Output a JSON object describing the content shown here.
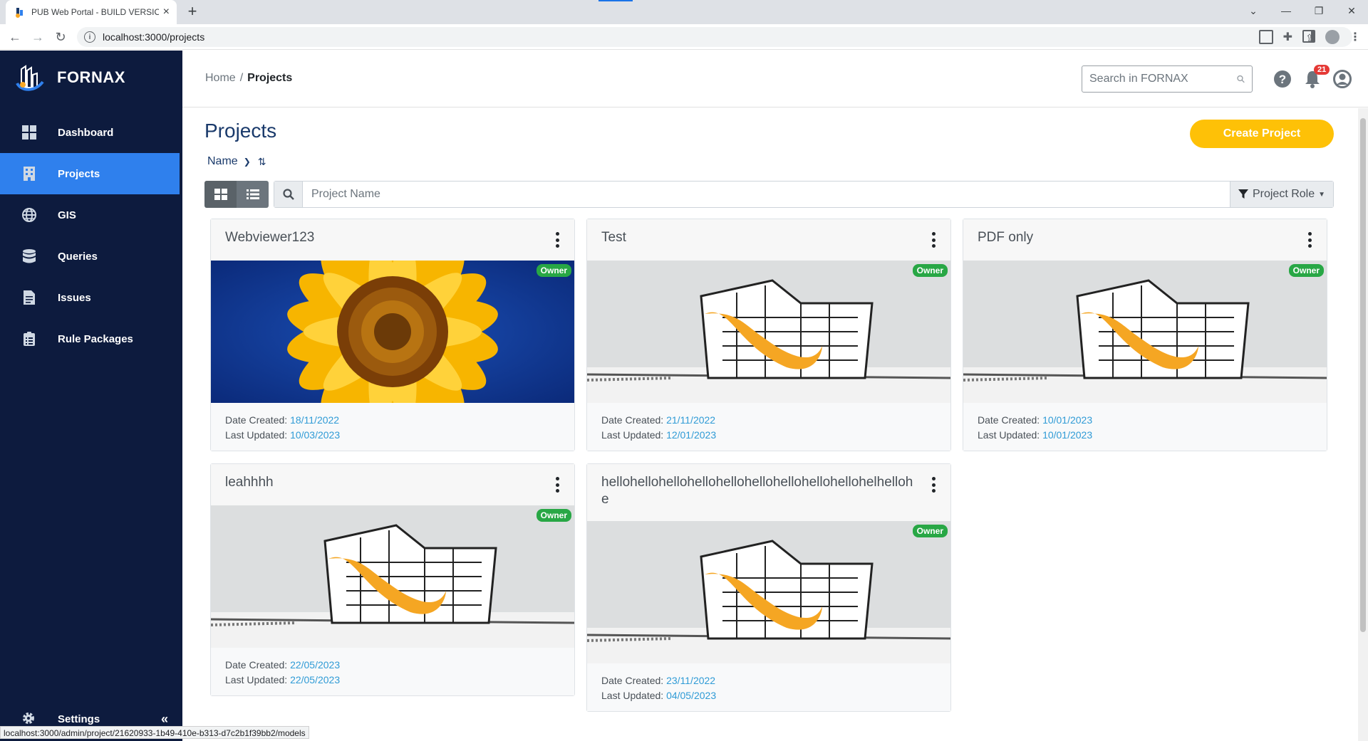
{
  "browser": {
    "tab_title": "PUB Web Portal - BUILD VERSION",
    "url": "localhost:3000/projects",
    "status_url": "localhost:3000/admin/project/21620933-1b49-410e-b313-d7c2b1f39bb2/models"
  },
  "sidebar": {
    "brand": "FORNAX",
    "items": [
      {
        "label": "Dashboard",
        "icon": "dashboard-grid-icon"
      },
      {
        "label": "Projects",
        "icon": "building-icon",
        "active": true
      },
      {
        "label": "GIS",
        "icon": "globe-icon"
      },
      {
        "label": "Queries",
        "icon": "database-icon"
      },
      {
        "label": "Issues",
        "icon": "document-icon"
      },
      {
        "label": "Rule Packages",
        "icon": "clipboard-list-icon"
      }
    ],
    "settings_label": "Settings"
  },
  "header": {
    "breadcrumb_home": "Home",
    "breadcrumb_sep": "/",
    "breadcrumb_current": "Projects",
    "search_placeholder": "Search in FORNAX",
    "notification_count": "21"
  },
  "main": {
    "title": "Projects",
    "create_label": "Create Project",
    "sort_label": "Name",
    "filter_placeholder": "Project Name",
    "role_label": "Project Role"
  },
  "labels": {
    "date_created": "Date Created: ",
    "last_updated": "Last Updated: ",
    "owner": "Owner"
  },
  "projects": [
    {
      "name": "Webviewer123",
      "role": "Owner",
      "date_created": "18/11/2022",
      "last_updated": "10/03/2023",
      "image": "sunflower"
    },
    {
      "name": "Test",
      "role": "Owner",
      "date_created": "21/11/2022",
      "last_updated": "12/01/2023",
      "image": "building"
    },
    {
      "name": "PDF only",
      "role": "Owner",
      "date_created": "10/01/2023",
      "last_updated": "10/01/2023",
      "image": "building"
    },
    {
      "name": "leahhhh",
      "role": "Owner",
      "date_created": "22/05/2023",
      "last_updated": "22/05/2023",
      "image": "building"
    },
    {
      "name": "hellohellohellohellohellohellohellohellohellohelhellohe",
      "role": "Owner",
      "date_created": "23/11/2022",
      "last_updated": "04/05/2023",
      "image": "building"
    }
  ],
  "colors": {
    "sidebar_bg": "#0d1b3e",
    "active_nav": "#2f80ed",
    "create_button": "#fec107",
    "owner_badge": "#28a745",
    "date_value": "#2f9bd6"
  }
}
